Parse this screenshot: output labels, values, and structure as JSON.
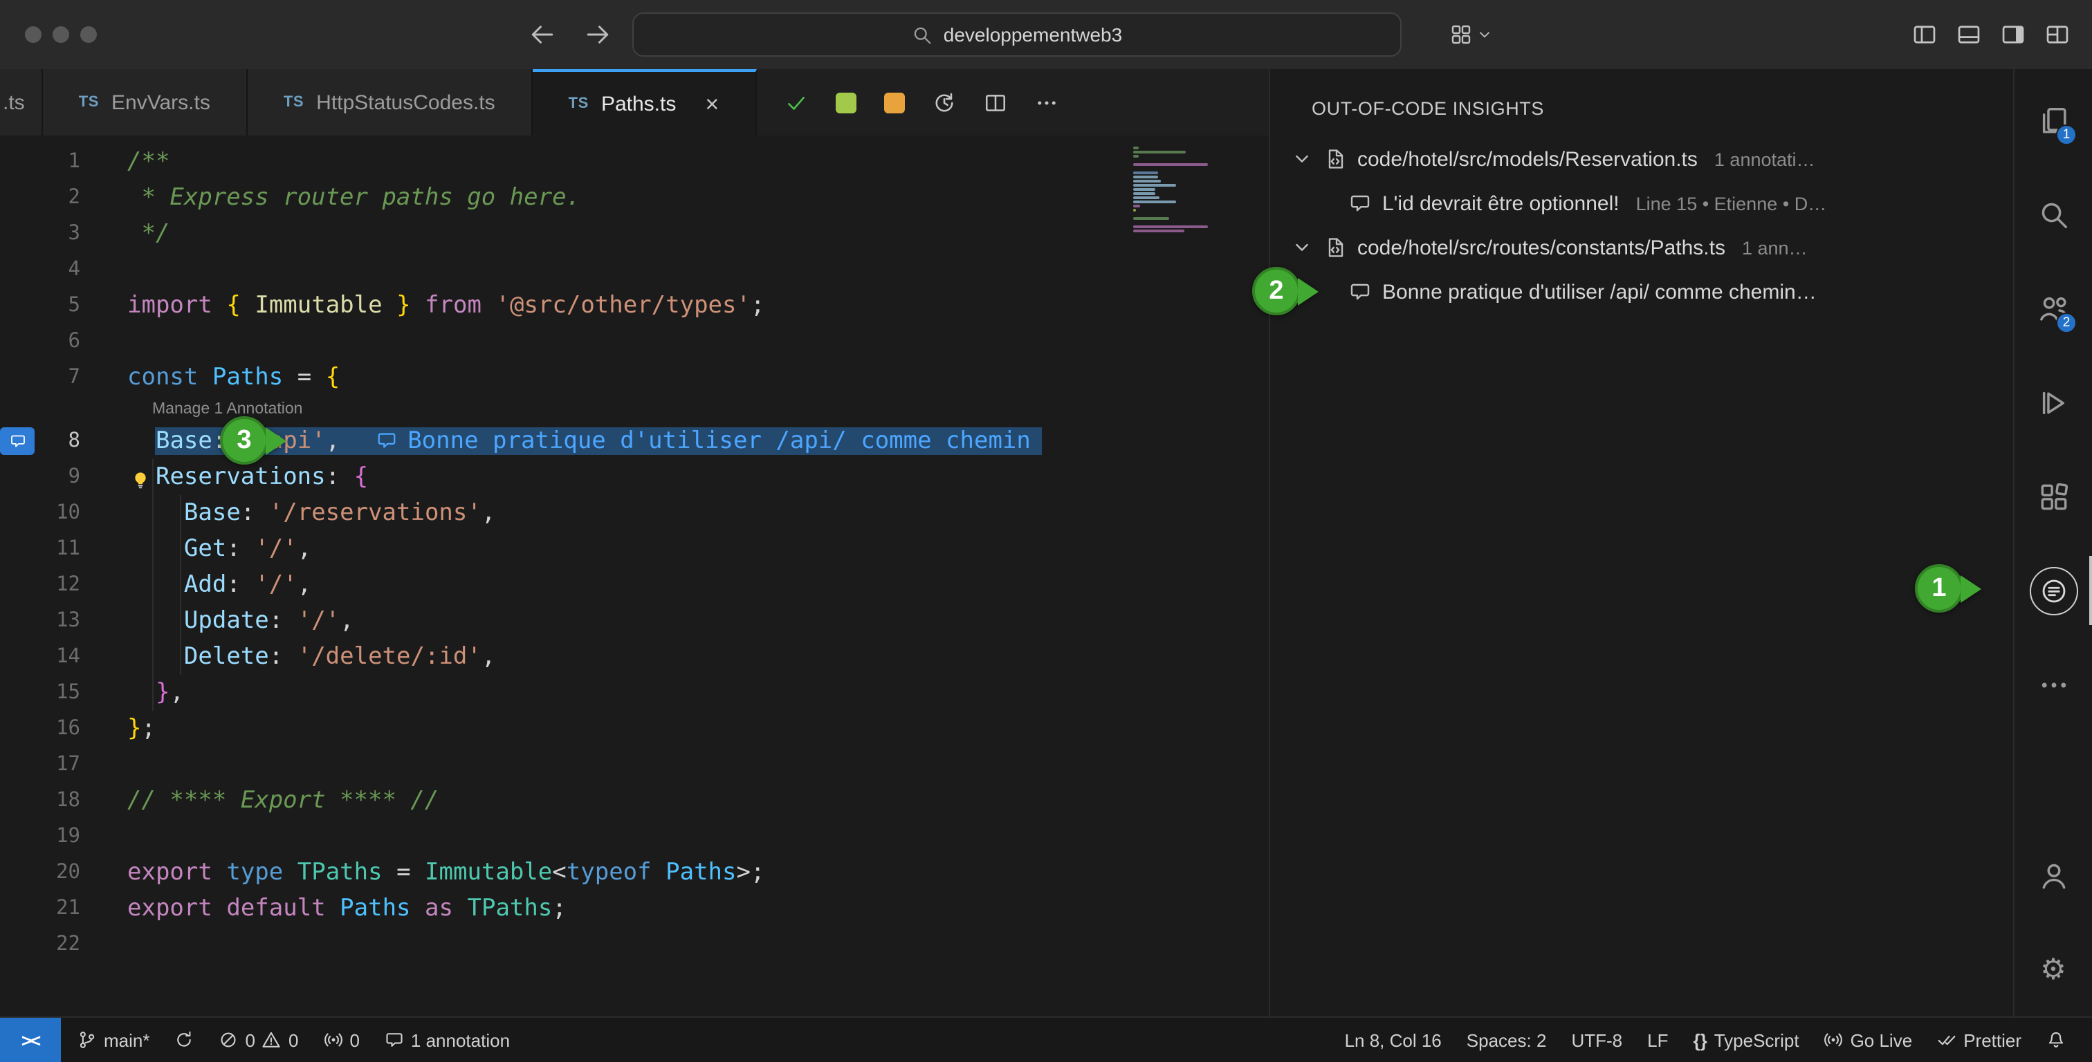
{
  "titlebar": {
    "search_value": "developpementweb3"
  },
  "tabs": [
    {
      "label": ".ts",
      "stub": true,
      "ts_icon": false,
      "active": false,
      "close": false
    },
    {
      "label": "EnvVars.ts",
      "ts_icon": true,
      "active": false,
      "close": false
    },
    {
      "label": "HttpStatusCodes.ts",
      "ts_icon": true,
      "active": false,
      "close": false
    },
    {
      "label": "Paths.ts",
      "ts_icon": true,
      "active": true,
      "close": true
    }
  ],
  "editor": {
    "lens": "Manage 1 Annotation",
    "inline_annotation": "Bonne pratique d'utiliser /api/ comme chemin",
    "lines": [
      {
        "n": 1,
        "tokens": [
          [
            "/**",
            "com"
          ]
        ]
      },
      {
        "n": 2,
        "tokens": [
          [
            " * Express router paths go here.",
            "com"
          ]
        ]
      },
      {
        "n": 3,
        "tokens": [
          [
            " */",
            "com"
          ]
        ]
      },
      {
        "n": 4,
        "tokens": []
      },
      {
        "n": 5,
        "tokens": [
          [
            "import",
            "kw"
          ],
          [
            " ",
            "pun"
          ],
          [
            "{",
            "br1"
          ],
          [
            " ",
            "pun"
          ],
          [
            "Immutable",
            "fn"
          ],
          [
            " ",
            "pun"
          ],
          [
            "}",
            "br1"
          ],
          [
            " ",
            "pun"
          ],
          [
            "from",
            "kw"
          ],
          [
            " ",
            "pun"
          ],
          [
            "'@src/other/types'",
            "str"
          ],
          [
            ";",
            "pun"
          ]
        ]
      },
      {
        "n": 6,
        "tokens": []
      },
      {
        "n": 7,
        "tokens": [
          [
            "const",
            "kw2"
          ],
          [
            " ",
            "pun"
          ],
          [
            "Paths",
            "var"
          ],
          [
            " = ",
            "pun"
          ],
          [
            "{",
            "br1"
          ]
        ]
      },
      {
        "n": 8,
        "lens": true,
        "highlight": true,
        "badge": true,
        "annotation": true,
        "tokens": [
          [
            "  ",
            "pun"
          ],
          [
            "Base",
            "prop"
          ],
          [
            ": ",
            "pun"
          ],
          [
            "'/api'",
            "str"
          ],
          [
            ",",
            "pun"
          ]
        ]
      },
      {
        "n": 9,
        "lightbulb": true,
        "tokens": [
          [
            "  ",
            "pun"
          ],
          [
            "Reservations",
            "prop"
          ],
          [
            ": ",
            "pun"
          ],
          [
            "{",
            "br2"
          ]
        ]
      },
      {
        "n": 10,
        "tokens": [
          [
            "    ",
            "pun"
          ],
          [
            "Base",
            "prop"
          ],
          [
            ": ",
            "pun"
          ],
          [
            "'/reservations'",
            "str"
          ],
          [
            ",",
            "pun"
          ]
        ]
      },
      {
        "n": 11,
        "tokens": [
          [
            "    ",
            "pun"
          ],
          [
            "Get",
            "prop"
          ],
          [
            ": ",
            "pun"
          ],
          [
            "'/'",
            "str"
          ],
          [
            ",",
            "pun"
          ]
        ]
      },
      {
        "n": 12,
        "tokens": [
          [
            "    ",
            "pun"
          ],
          [
            "Add",
            "prop"
          ],
          [
            ": ",
            "pun"
          ],
          [
            "'/'",
            "str"
          ],
          [
            ",",
            "pun"
          ]
        ]
      },
      {
        "n": 13,
        "tokens": [
          [
            "    ",
            "pun"
          ],
          [
            "Update",
            "prop"
          ],
          [
            ": ",
            "pun"
          ],
          [
            "'/'",
            "str"
          ],
          [
            ",",
            "pun"
          ]
        ]
      },
      {
        "n": 14,
        "tokens": [
          [
            "    ",
            "pun"
          ],
          [
            "Delete",
            "prop"
          ],
          [
            ": ",
            "pun"
          ],
          [
            "'/delete/:id'",
            "str"
          ],
          [
            ",",
            "pun"
          ]
        ]
      },
      {
        "n": 15,
        "tokens": [
          [
            "  ",
            "pun"
          ],
          [
            "}",
            "br2"
          ],
          [
            ",",
            "pun"
          ]
        ]
      },
      {
        "n": 16,
        "tokens": [
          [
            "}",
            "br1"
          ],
          [
            ";",
            "pun"
          ]
        ]
      },
      {
        "n": 17,
        "tokens": []
      },
      {
        "n": 18,
        "tokens": [
          [
            "// **** Export **** //",
            "com"
          ]
        ]
      },
      {
        "n": 19,
        "tokens": []
      },
      {
        "n": 20,
        "tokens": [
          [
            "export",
            "kw"
          ],
          [
            " ",
            "pun"
          ],
          [
            "type",
            "kw2"
          ],
          [
            " ",
            "pun"
          ],
          [
            "TPaths",
            "type"
          ],
          [
            " = ",
            "pun"
          ],
          [
            "Immutable",
            "type"
          ],
          [
            "<",
            "pun"
          ],
          [
            "typeof",
            "kw2"
          ],
          [
            " ",
            "pun"
          ],
          [
            "Paths",
            "var"
          ],
          [
            ">",
            "pun"
          ],
          [
            ";",
            "pun"
          ]
        ]
      },
      {
        "n": 21,
        "tokens": [
          [
            "export",
            "kw"
          ],
          [
            " ",
            "pun"
          ],
          [
            "default",
            "kw"
          ],
          [
            " ",
            "pun"
          ],
          [
            "Paths",
            "var"
          ],
          [
            " ",
            "pun"
          ],
          [
            "as",
            "kw"
          ],
          [
            " ",
            "pun"
          ],
          [
            "TPaths",
            "type"
          ],
          [
            ";",
            "pun"
          ]
        ]
      },
      {
        "n": 22,
        "tokens": []
      }
    ]
  },
  "insights": {
    "title": "OUT-OF-CODE INSIGHTS",
    "rows": [
      {
        "kind": "file",
        "label": "code/hotel/src/models/Reservation.ts",
        "meta": "1 annotati…"
      },
      {
        "kind": "note",
        "label": "L'id devrait être optionnel!",
        "meta": "Line 15 • Etienne • D…"
      },
      {
        "kind": "file",
        "label": "code/hotel/src/routes/constants/Paths.ts",
        "meta": "1 ann…"
      },
      {
        "kind": "note",
        "label": "Bonne pratique d'utiliser /api/ comme chemin…",
        "meta": ""
      }
    ]
  },
  "activity": {
    "items": [
      {
        "name": "explorer",
        "icon": "files",
        "badge": "1"
      },
      {
        "name": "search",
        "icon": "search"
      },
      {
        "name": "accounts",
        "icon": "people",
        "badge": "2"
      },
      {
        "name": "run",
        "icon": "run"
      },
      {
        "name": "extensions",
        "icon": "extensions"
      },
      {
        "name": "annotations",
        "icon": "annotations-circle",
        "active": true
      },
      {
        "name": "more",
        "icon": "more"
      },
      {
        "name": "account",
        "icon": "person",
        "footer": true
      },
      {
        "name": "settings",
        "icon": "gear",
        "footer": true
      }
    ]
  },
  "status": {
    "remote": "><",
    "left": [
      {
        "name": "branch",
        "parts": [
          {
            "i": "git-branch"
          },
          {
            "t": "main*"
          }
        ]
      },
      {
        "name": "sync",
        "parts": [
          {
            "i": "sync"
          }
        ]
      },
      {
        "name": "problems",
        "parts": [
          {
            "i": "error"
          },
          {
            "t": "0"
          },
          {
            "i": "warning"
          },
          {
            "t": "0"
          }
        ]
      },
      {
        "name": "ports",
        "parts": [
          {
            "i": "broadcast"
          },
          {
            "t": "0"
          }
        ]
      },
      {
        "name": "annotations",
        "parts": [
          {
            "i": "comment"
          },
          {
            "t": "1 annotation"
          }
        ]
      }
    ],
    "right": [
      {
        "name": "cursor-position",
        "parts": [
          {
            "t": "Ln 8, Col 16"
          }
        ]
      },
      {
        "name": "indentation",
        "parts": [
          {
            "t": "Spaces: 2"
          }
        ]
      },
      {
        "name": "encoding",
        "parts": [
          {
            "t": "UTF-8"
          }
        ]
      },
      {
        "name": "eol",
        "parts": [
          {
            "t": "LF"
          }
        ]
      },
      {
        "name": "language",
        "parts": [
          {
            "i": "braces"
          },
          {
            "t": "TypeScript"
          }
        ]
      },
      {
        "name": "go-live",
        "parts": [
          {
            "i": "broadcast"
          },
          {
            "t": "Go Live"
          }
        ]
      },
      {
        "name": "prettier",
        "parts": [
          {
            "i": "double-check"
          },
          {
            "t": "Prettier"
          }
        ]
      },
      {
        "name": "notifications",
        "parts": [
          {
            "i": "bell"
          }
        ]
      }
    ]
  },
  "callouts": [
    {
      "num": "1"
    },
    {
      "num": "2"
    },
    {
      "num": "3"
    }
  ],
  "colors": {
    "accent_blue": "#3da2f5",
    "badge_blue": "#2472c8",
    "remote_blue": "#2472c8",
    "callout_green": "#41a832",
    "annotation_blue": "#4da6ff",
    "highlight_line": "#23496e",
    "check_green": "#4cc04c",
    "square_green": "#a3c94a",
    "square_orange": "#e8a33d"
  }
}
